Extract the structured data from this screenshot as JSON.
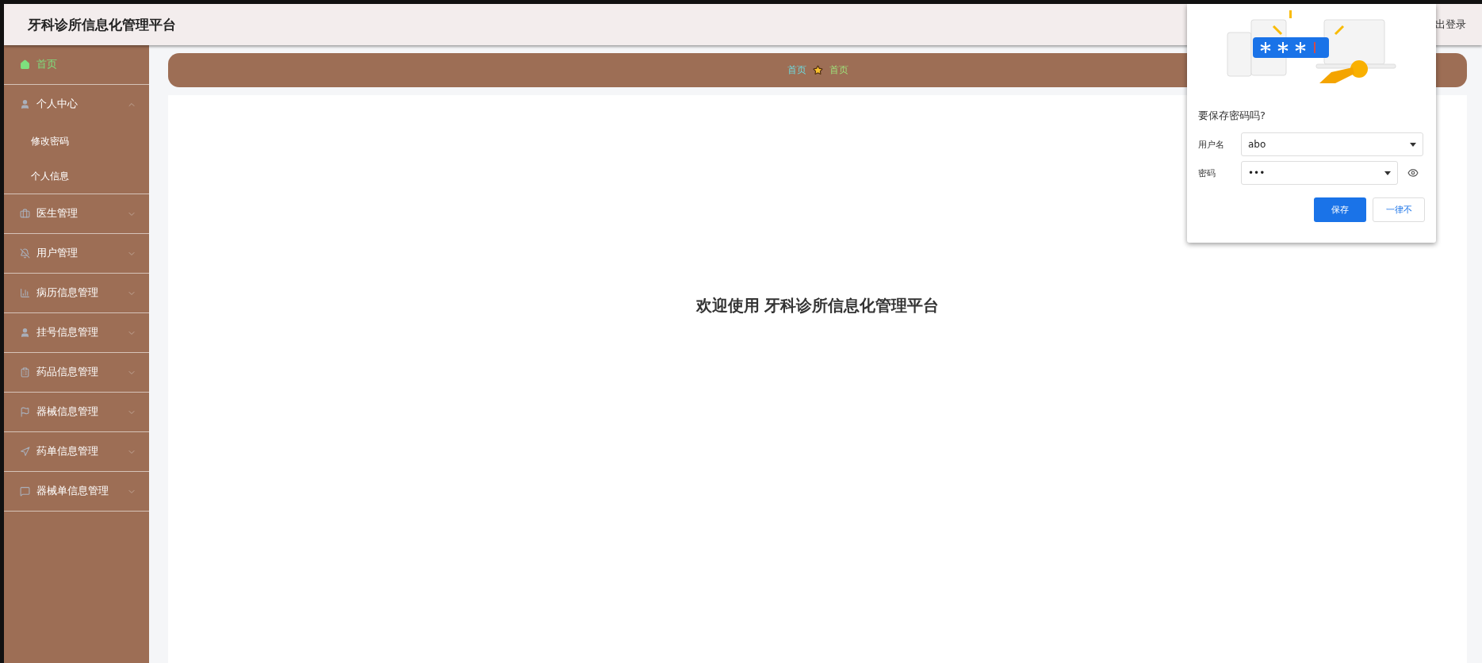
{
  "header": {
    "title": "牙科诊所信息化管理平台",
    "logout": "出登录"
  },
  "sidebar": {
    "items": [
      {
        "label": "首页",
        "selected": true
      },
      {
        "label": "个人中心",
        "selected": false,
        "expanded": true,
        "children": [
          {
            "label": "修改密码"
          },
          {
            "label": "个人信息"
          }
        ]
      },
      {
        "label": "医生管理",
        "selected": false,
        "expanded": false
      },
      {
        "label": "用户管理",
        "selected": false,
        "expanded": false
      },
      {
        "label": "病历信息管理",
        "selected": false,
        "expanded": false
      },
      {
        "label": "挂号信息管理",
        "selected": false,
        "expanded": false
      },
      {
        "label": "药品信息管理",
        "selected": false,
        "expanded": false
      },
      {
        "label": "器械信息管理",
        "selected": false,
        "expanded": false
      },
      {
        "label": "药单信息管理",
        "selected": false,
        "expanded": false
      },
      {
        "label": "器械单信息管理",
        "selected": false,
        "expanded": false
      }
    ]
  },
  "breadcrumb": [
    {
      "label": "首页",
      "selected": false
    },
    {
      "label": "首页",
      "selected": true
    }
  ],
  "welcome": "欢迎使用 牙科诊所信息化管理平台",
  "password_popup": {
    "title": "要保存密码吗?",
    "username_label": "用户名",
    "username": "abo",
    "password_label": "密码",
    "password": "•••",
    "buttons": [
      {
        "label": "保存",
        "kind": "primary"
      },
      {
        "label": "一律不",
        "kind": "secondary"
      }
    ]
  }
}
